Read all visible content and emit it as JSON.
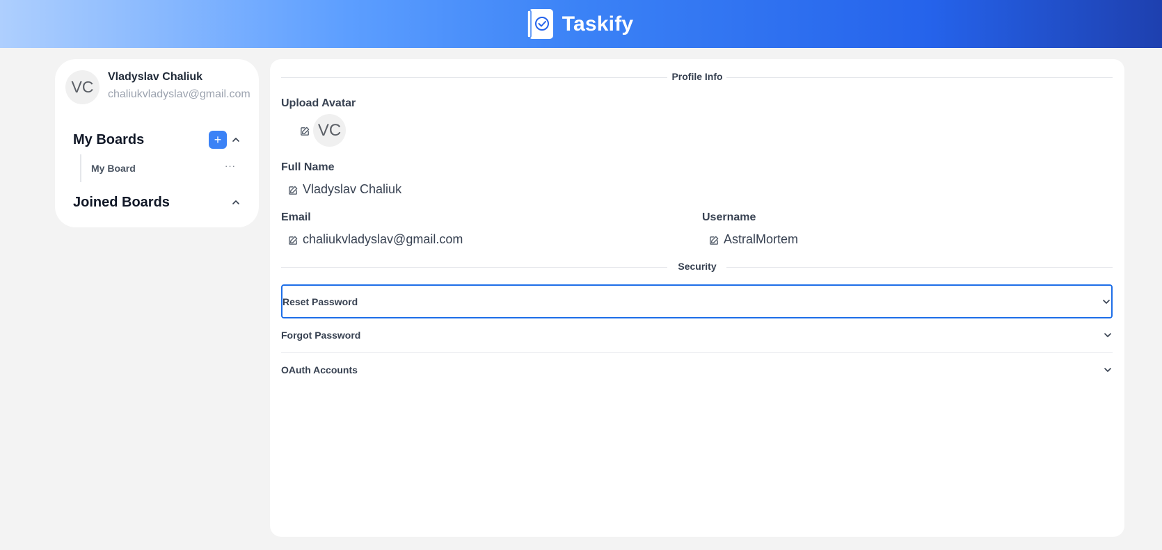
{
  "header": {
    "app_title": "Taskify",
    "logo_icon": "notebook-check-icon"
  },
  "sidebar": {
    "user": {
      "initials": "VC",
      "name": "Vladyslav Chaliuk",
      "email": "chaliukvladyslav@gmail.com"
    },
    "my_boards": {
      "heading": "My Boards",
      "add_icon": "+",
      "items": [
        {
          "label": "My Board",
          "more": "···"
        }
      ]
    },
    "joined_boards": {
      "heading": "Joined Boards"
    }
  },
  "profile": {
    "section_title": "Profile Info",
    "upload_avatar_label": "Upload Avatar",
    "avatar_initials": "VC",
    "full_name_label": "Full Name",
    "full_name_value": "Vladyslav Chaliuk",
    "email_label": "Email",
    "email_value": "chaliukvladyslav@gmail.com",
    "username_label": "Username",
    "username_value": "AstralMortem"
  },
  "security": {
    "section_title": "Security",
    "items": [
      {
        "label": "Reset Password"
      },
      {
        "label": "Forgot Password"
      },
      {
        "label": "OAuth Accounts"
      }
    ]
  },
  "colors": {
    "accent": "#3b82f6",
    "focus_border": "#1d6ee8",
    "header_start": "#aecffe",
    "header_end": "#1e40af"
  }
}
